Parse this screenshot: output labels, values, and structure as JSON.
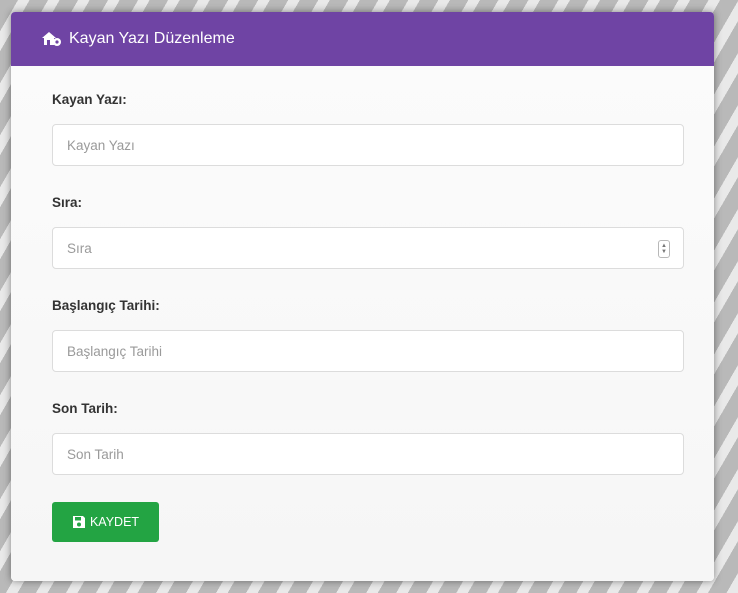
{
  "header": {
    "title": "Kayan Yazı Düzenleme",
    "icon": "house-gear-icon"
  },
  "form": {
    "fields": [
      {
        "label": "Kayan Yazı:",
        "placeholder": "Kayan Yazı",
        "value": "",
        "type": "text"
      },
      {
        "label": "Sıra:",
        "placeholder": "Sıra",
        "value": "",
        "type": "number"
      },
      {
        "label": "Başlangıç Tarihi:",
        "placeholder": "Başlangıç Tarihi",
        "value": "",
        "type": "text"
      },
      {
        "label": "Son Tarih:",
        "placeholder": "Son Tarih",
        "value": "",
        "type": "text"
      }
    ],
    "save_label": "KAYDET",
    "save_icon": "floppy-disk-icon"
  },
  "colors": {
    "header_bg": "#6f44a4",
    "save_button_bg": "#23a443"
  }
}
